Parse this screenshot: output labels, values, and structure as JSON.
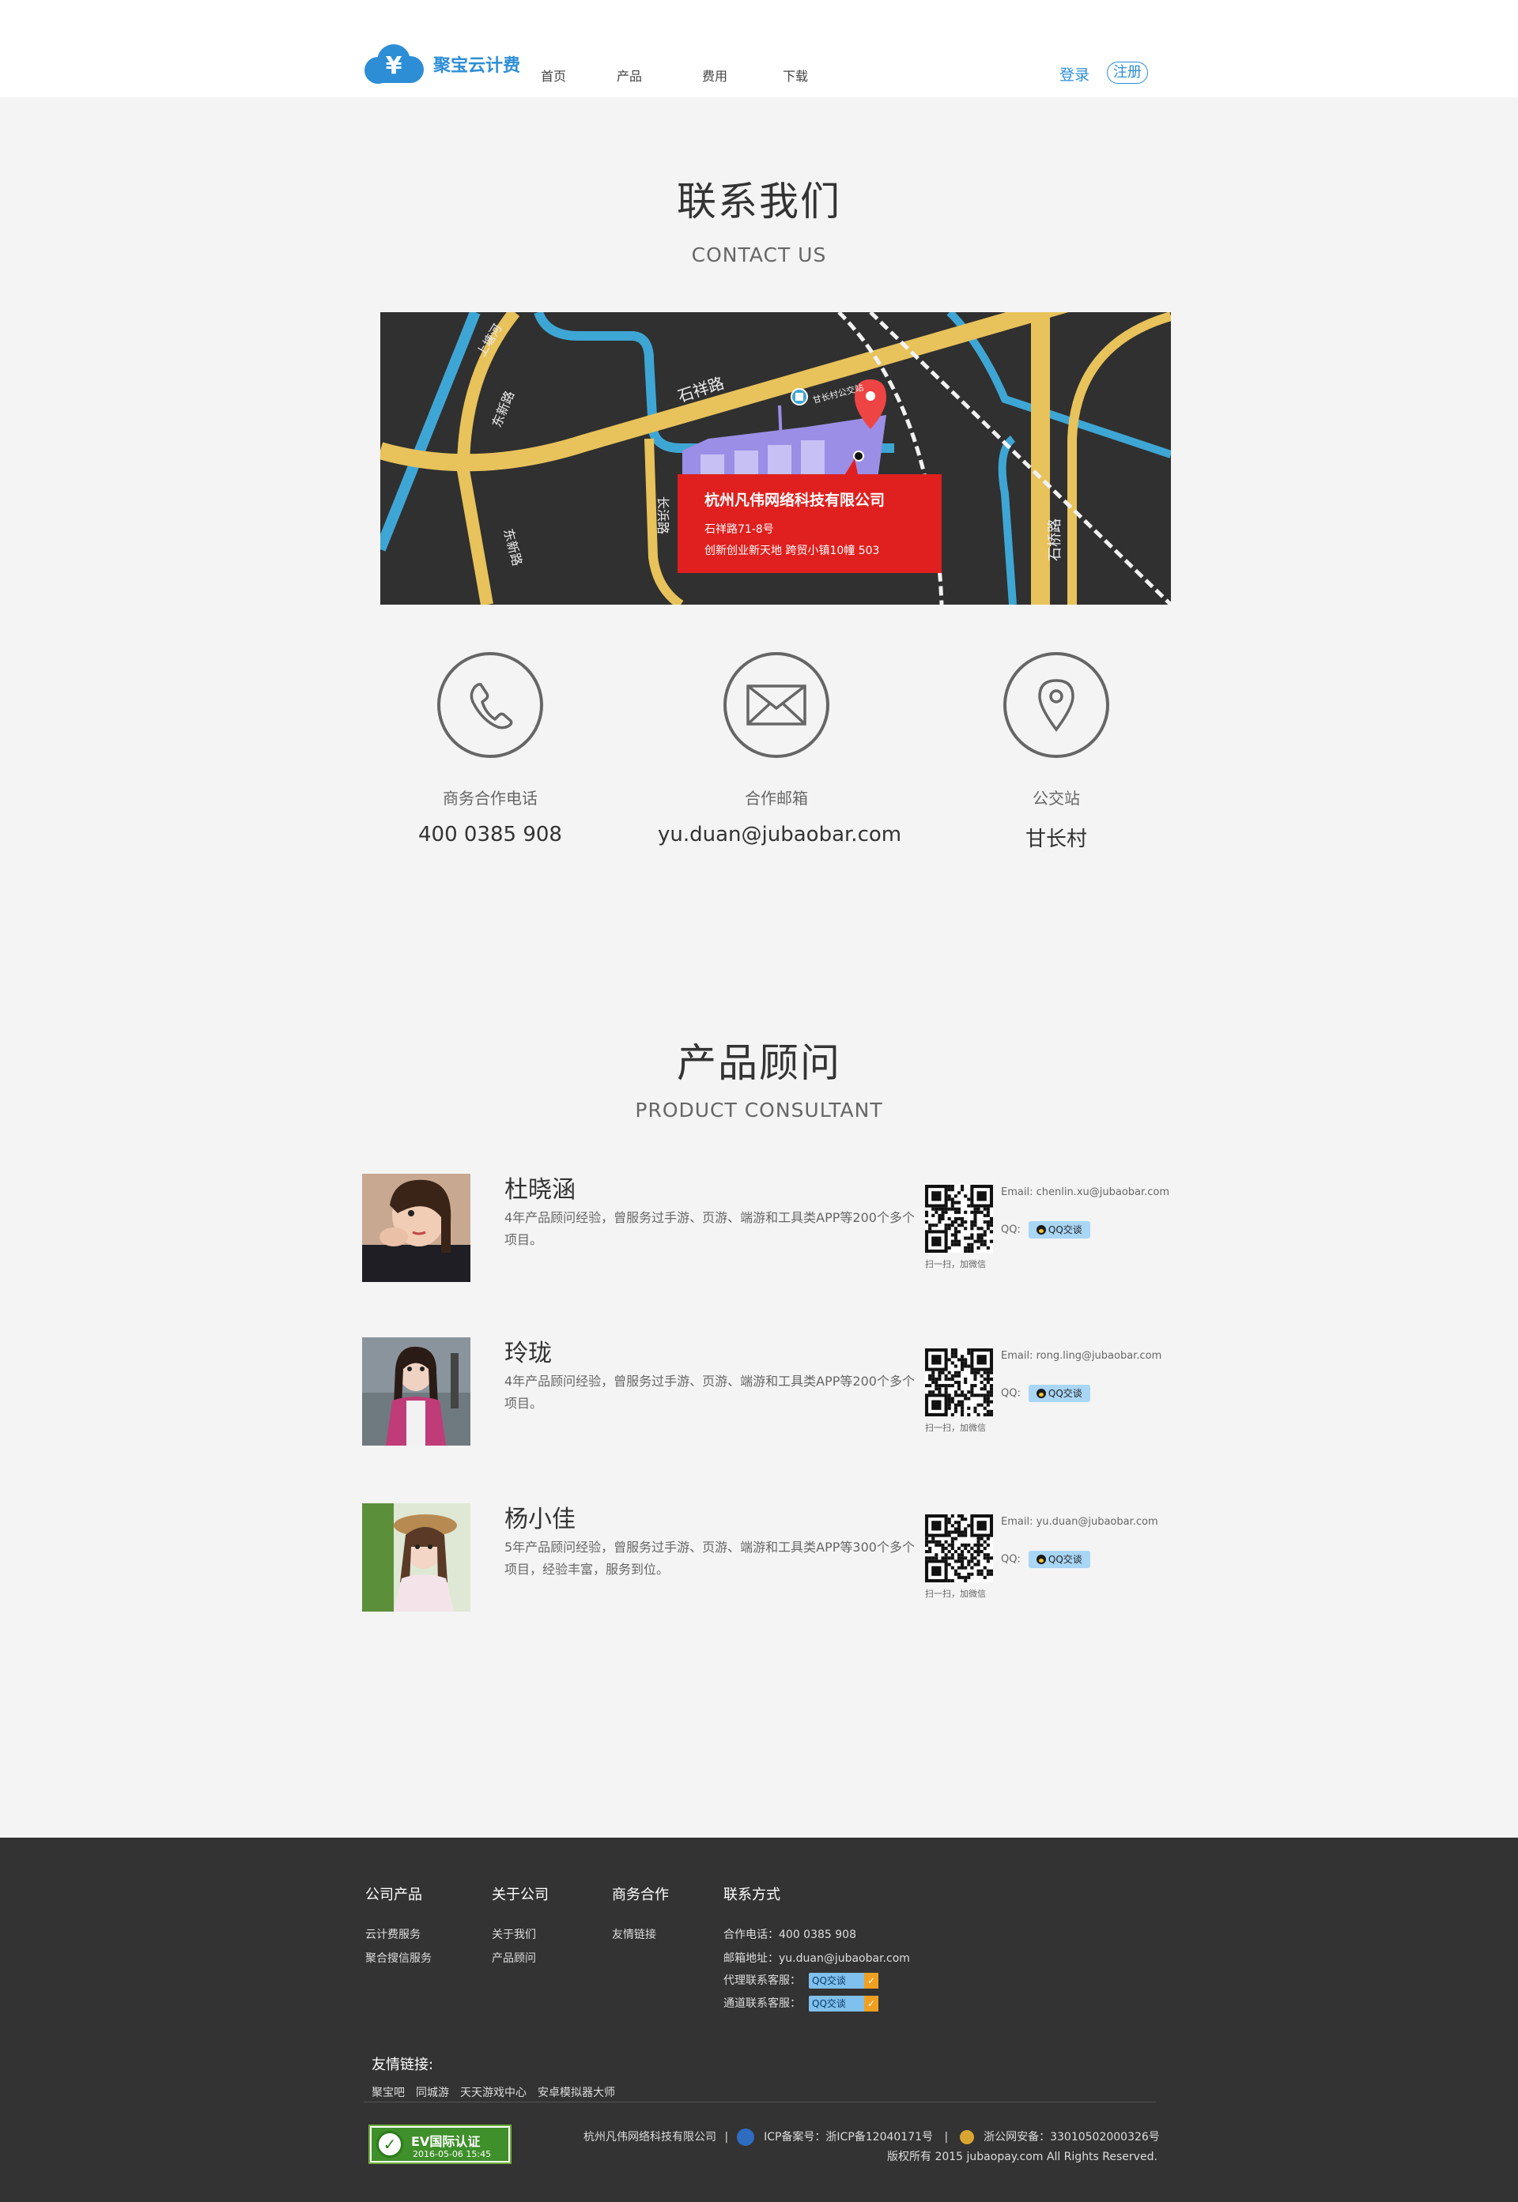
{
  "header": {
    "brand": "聚宝云计费",
    "nav": [
      "首页",
      "产品",
      "费用",
      "下载"
    ],
    "login": "登录",
    "register": "注册",
    "brand_color": "#2d8ed6"
  },
  "contact": {
    "title": "联系我们",
    "subtitle": "CONTACT US",
    "map": {
      "roads": [
        "上塘河",
        "东新路",
        "东新路",
        "石祥路",
        "长浜路",
        "石桥路"
      ],
      "bus_stop": "甘长村公交站",
      "company": "杭州凡伟网络科技有限公司",
      "address_line1": "石祥路71-8号",
      "address_line2": "创新创业新天地 跨贸小镇10幢 503"
    },
    "items": [
      {
        "label": "商务合作电话",
        "value": "400 0385 908",
        "icon": "phone-icon"
      },
      {
        "label": "合作邮箱",
        "value": "yu.duan@jubaobar.com",
        "icon": "mail-icon"
      },
      {
        "label": "公交站",
        "value": "甘长村",
        "icon": "location-pin-icon"
      }
    ]
  },
  "consultant": {
    "title": "产品顾问",
    "subtitle": "PRODUCT CONSULTANT",
    "qr_caption": "扫一扫，加微信",
    "email_label": "Email:",
    "qq_label": "QQ:",
    "qq_button": "QQ交谈",
    "people": [
      {
        "name": "杜晓涵",
        "desc": "4年产品顾问经验，曾服务过手游、页游、端游和工具类APP等200个多个项目。",
        "email": "chenlin.xu@jubaobar.com"
      },
      {
        "name": "玲珑",
        "desc": "4年产品顾问经验，曾服务过手游、页游、端游和工具类APP等200个多个项目。",
        "email": "rong.ling@jubaobar.com"
      },
      {
        "name": "杨小佳",
        "desc": "5年产品顾问经验，曾服务过手游、页游、端游和工具类APP等300个多个项目，经验丰富，服务到位。",
        "email": "yu.duan@jubaobar.com"
      }
    ]
  },
  "footer": {
    "columns": [
      {
        "title": "公司产品",
        "items": [
          "云计费服务",
          "聚合搜信服务"
        ]
      },
      {
        "title": "关于公司",
        "items": [
          "关于我们",
          "产品顾问"
        ]
      },
      {
        "title": "商务合作",
        "items": [
          "友情链接"
        ]
      },
      {
        "title": "联系方式",
        "items": [
          "合作电话：400 0385 908",
          "邮箱地址：yu.duan@jubaobar.com",
          "代理联系客服：",
          "通道联系客服："
        ]
      }
    ],
    "qq_button": "QQ交谈",
    "links_title": "友情链接:",
    "links": [
      "聚宝吧",
      "同城游",
      "天天游戏中心",
      "安卓模拟器大师"
    ],
    "ev_title": "EV国际认证",
    "ev_date": "2016-05-06 15:45",
    "company": "杭州凡伟网络科技有限公司",
    "icp": "ICP备案号：浙ICP备12040171号",
    "police": "浙公网安备：33010502000326号",
    "copyright": "版权所有 2015 jubaopay.com All Rights Reserved."
  }
}
